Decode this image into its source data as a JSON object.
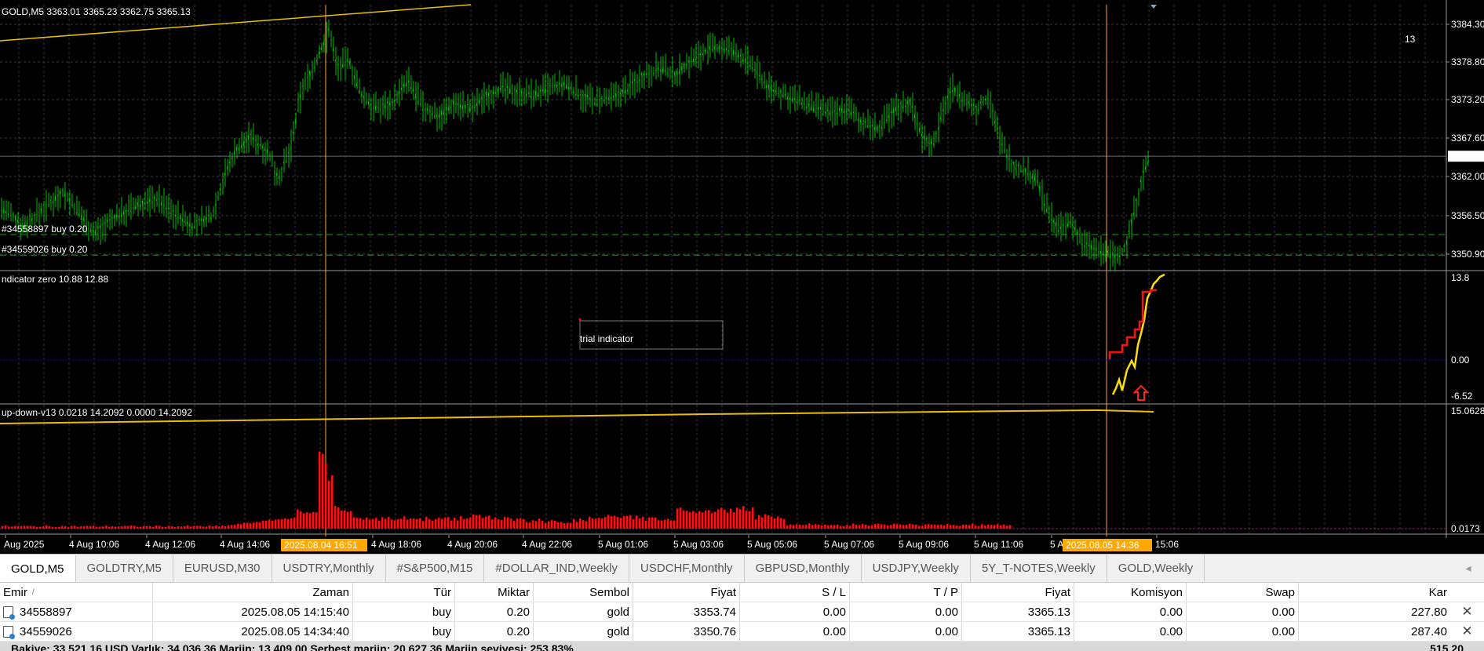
{
  "chart": {
    "symbol_header": "GOLD,M5  3363.01 3365.23 3362.75 3365.13",
    "big_number": "13",
    "order_lines": [
      {
        "label": "#34558897 buy 0.20",
        "price": 3353.74
      },
      {
        "label": "#34559026 buy 0.20",
        "price": 3350.76
      }
    ],
    "price_axis_labels": [
      "3384.30",
      "3378.80",
      "3373.20",
      "3367.60",
      "3362.00",
      "3356.50",
      "3350.90"
    ],
    "current_price_label": "3365.13",
    "indicator1": {
      "header": "ndicator zero 10.88 12.88",
      "scale_labels": [
        "13.8",
        "0.00",
        "-6.52"
      ],
      "watermark": "trial indicator"
    },
    "indicator2": {
      "header": "up-down-v13 0.0218 14.2092 0.0000 14.2092",
      "scale_labels": [
        "15.0628",
        "0.0173"
      ]
    },
    "time_axis_labels": [
      "Aug 2025",
      "4 Aug 10:06",
      "4 Aug 12:06",
      "4 Aug 14:06",
      "4 Aug 18:06",
      "4 Aug 20:06",
      "4 Aug 22:06",
      "5 Aug 01:06",
      "5 Aug 03:06",
      "5 Aug 05:06",
      "5 Aug 07:06",
      "5 Aug 09:06",
      "5 Aug 11:06",
      "5 A",
      "15:06"
    ],
    "crosshair_time_1": "2025.08.04 16:51",
    "crosshair_time_2": "2025.08.05 14:36",
    "colors": {
      "candles": "#00c000",
      "ma_line": "#e8c000",
      "grid": "#3a3a3a",
      "order_line": "#00b000",
      "histogram": "#ff1010",
      "watermark": "#ff8a00",
      "crosshair_label_bg": "#ffa800"
    }
  },
  "tabs": [
    {
      "label": "GOLD,M5",
      "active": true
    },
    {
      "label": "GOLDTRY,M5"
    },
    {
      "label": "EURUSD,M30"
    },
    {
      "label": "USDTRY,Monthly"
    },
    {
      "label": "#S&P500,M15"
    },
    {
      "label": "#DOLLAR_IND,Weekly"
    },
    {
      "label": "USDCHF,Monthly"
    },
    {
      "label": "GBPUSD,Monthly"
    },
    {
      "label": "USDJPY,Weekly"
    },
    {
      "label": "5Y_T-NOTES,Weekly"
    },
    {
      "label": "GOLD,Weekly"
    }
  ],
  "tab_scroll": "◂",
  "orders": {
    "headers": {
      "emir": "Emir",
      "zaman": "Zaman",
      "tur": "Tür",
      "miktar": "Miktar",
      "sembol": "Sembol",
      "fiyat": "Fiyat",
      "sl": "S / L",
      "tp": "T / P",
      "fiyat2": "Fiyat",
      "komisyon": "Komisyon",
      "swap": "Swap",
      "kar": "Kar"
    },
    "rows": [
      {
        "emir": "34558897",
        "zaman": "2025.08.05 14:15:40",
        "tur": "buy",
        "miktar": "0.20",
        "sembol": "gold",
        "fiyat": "3353.74",
        "sl": "0.00",
        "tp": "0.00",
        "fiyat2": "3365.13",
        "komisyon": "0.00",
        "swap": "0.00",
        "kar": "227.80"
      },
      {
        "emir": "34559026",
        "zaman": "2025.08.05 14:34:40",
        "tur": "buy",
        "miktar": "0.20",
        "sembol": "gold",
        "fiyat": "3350.76",
        "sl": "0.00",
        "tp": "0.00",
        "fiyat2": "3365.13",
        "komisyon": "0.00",
        "swap": "0.00",
        "kar": "287.40"
      }
    ],
    "balance": "Bakiye: 33 521.16 USD  Varlık: 34 036.36  Marjin: 13 409.00  Serbest marjin: 20 627.36  Marjin seviyesi: 253.83%",
    "balance_total": "515.20",
    "close_symbol": "✕"
  }
}
